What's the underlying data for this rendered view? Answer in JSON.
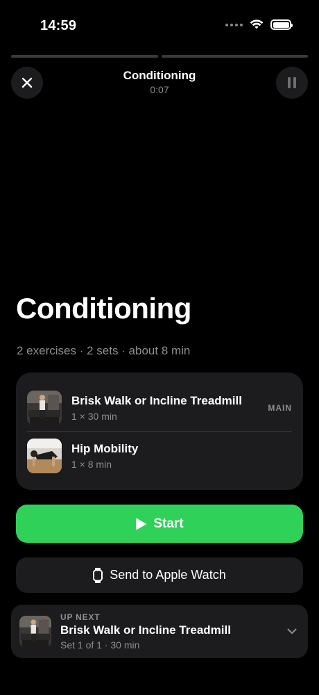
{
  "status_bar": {
    "time": "14:59"
  },
  "header": {
    "title": "Conditioning",
    "timer": "0:07"
  },
  "progress": {
    "segments": 2,
    "completed": 0
  },
  "workout": {
    "title": "Conditioning",
    "summary": "2 exercises · 2 sets · about 8 min"
  },
  "exercises": [
    {
      "name": "Brisk Walk or Incline Treadmill",
      "detail": "1 × 30 min",
      "tag": "MAIN"
    },
    {
      "name": "Hip Mobility",
      "detail": "1 × 8 min",
      "tag": ""
    }
  ],
  "actions": {
    "start_label": "Start",
    "watch_label": "Send to Apple Watch"
  },
  "up_next": {
    "caption": "UP NEXT",
    "name": "Brisk Walk or Incline Treadmill",
    "detail": "Set 1 of 1 · 30 min"
  },
  "colors": {
    "accent_green": "#30d158",
    "card": "#1c1c1e",
    "secondary_text": "#8e8e93"
  },
  "icons": [
    "close-icon",
    "pause-icon",
    "play-icon",
    "apple-watch-icon",
    "chevron-down-icon",
    "wifi-icon",
    "battery-icon",
    "cellular-icon"
  ]
}
